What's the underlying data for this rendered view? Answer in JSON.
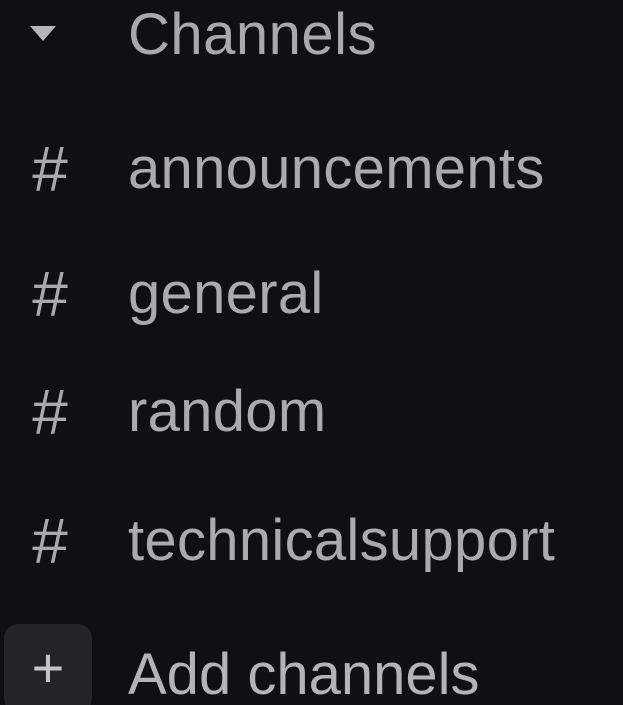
{
  "section": {
    "title": "Channels",
    "caret_icon": "caret-down-icon"
  },
  "channels": [
    {
      "prefix": "#",
      "label": "announcements"
    },
    {
      "prefix": "#",
      "label": "general"
    },
    {
      "prefix": "#",
      "label": "random"
    },
    {
      "prefix": "#",
      "label": "technicalsupport"
    }
  ],
  "add_channels": {
    "icon_glyph": "+",
    "label": "Add channels"
  },
  "colors": {
    "background": "#0f0f14",
    "text": "#ababaf",
    "add_button_bg": "#232328"
  }
}
